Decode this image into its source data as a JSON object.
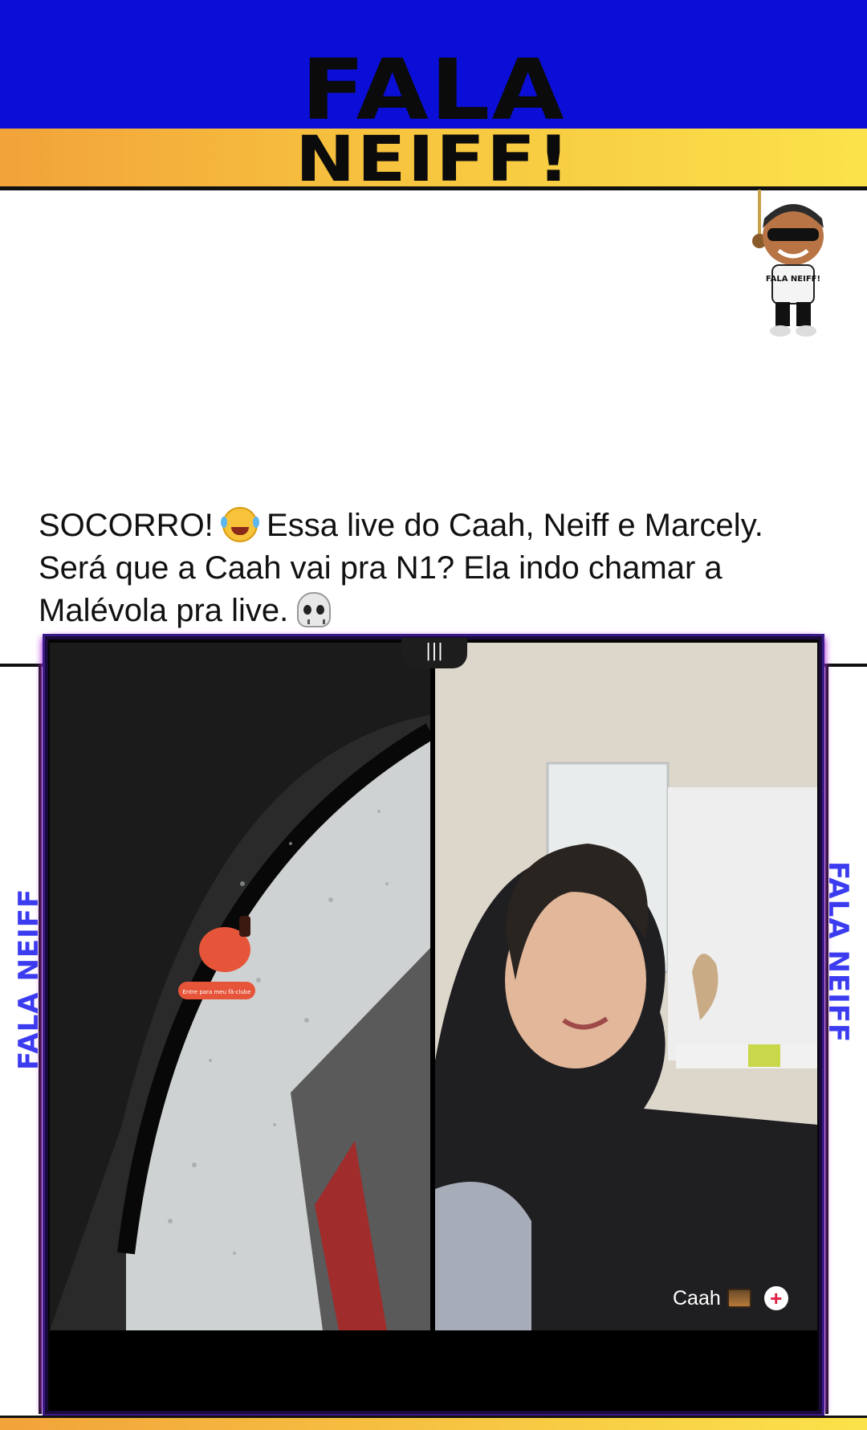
{
  "header": {
    "logo_line1": "FALA",
    "logo_line2": "NEIFF!",
    "colors": {
      "blue": "#0a0ed6",
      "yellow": "#fbe24a",
      "orange": "#f2a33a",
      "accent_text": "#3b3bf0"
    }
  },
  "mascot": {
    "icon": "mascot-character-icon",
    "shirt_text": "FALA NEIFF!"
  },
  "post": {
    "caption_part1": "SOCORRO!",
    "emoji1": "laughing-tears-emoji",
    "caption_part2": "Essa live do Caah, Neiff e Marcely. Será que a Caah vai pra N1? Ela indo chamar a Malévola pra live.",
    "emoji2": "skull-emoji"
  },
  "side_labels": {
    "left": "FALA NEIFF",
    "right": "FALA NEIFF"
  },
  "live": {
    "top_handle_icon": "bars-icon",
    "right_user_name": "Caah",
    "right_user_emoji": "house-emoji",
    "follow_icon": "plus-icon",
    "sticker_text": "Entre para meu fã-clube"
  }
}
